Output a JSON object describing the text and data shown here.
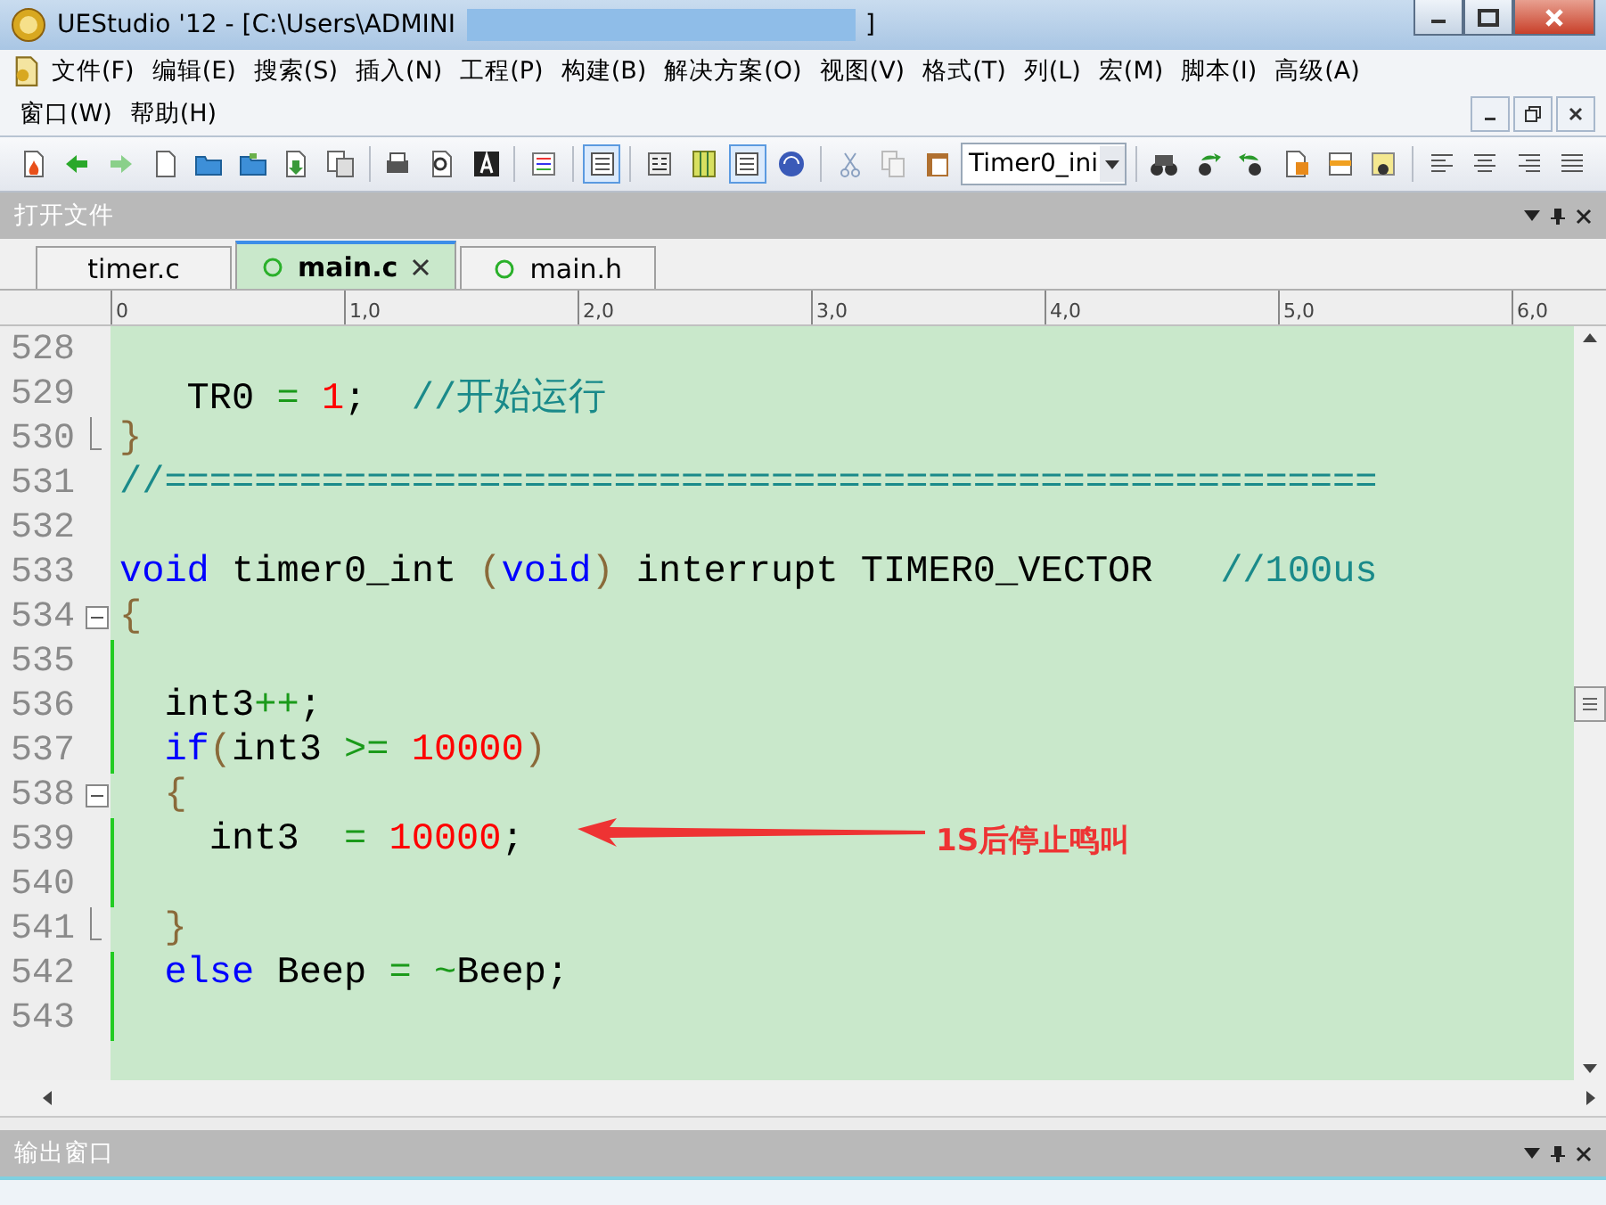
{
  "window": {
    "title": "UEStudio '12 - [C:\\Users\\ADMINI",
    "title_end": "]"
  },
  "menu": [
    "文件(F)",
    "编辑(E)",
    "搜索(S)",
    "插入(N)",
    "工程(P)",
    "构建(B)",
    "解决方案(O)",
    "视图(V)",
    "格式(T)",
    "列(L)",
    "宏(M)",
    "脚本(I)",
    "高级(A)",
    "窗口(W)",
    "帮助(H)"
  ],
  "toolbar": {
    "function_combo": "Timer0_ini"
  },
  "open_files_panel": {
    "title": "打开文件"
  },
  "tabs": [
    {
      "label": "timer.c",
      "selected": false,
      "marker": false
    },
    {
      "label": "main.c",
      "selected": true,
      "marker": true
    },
    {
      "label": "main.h",
      "selected": false,
      "marker": true
    }
  ],
  "ruler": [
    "0",
    "1,0",
    "2,0",
    "3,0",
    "4,0",
    "5,0",
    "6,0"
  ],
  "code_lines": [
    {
      "number": "528",
      "modified": false,
      "fold_start": false,
      "fold_end": false
    },
    {
      "number": "529",
      "modified": false,
      "fold_start": false,
      "fold_end": false,
      "tokens": [
        {
          "kind": "plain",
          "text": "   TR0 "
        },
        {
          "kind": "op",
          "text": "= "
        },
        {
          "kind": "number",
          "text": "1"
        },
        {
          "kind": "plain",
          "text": ";  "
        },
        {
          "kind": "comment",
          "text": "//开始运行"
        }
      ]
    },
    {
      "number": "530",
      "modified": false,
      "fold_start": false,
      "fold_end": true,
      "tokens": [
        {
          "kind": "bracket",
          "text": "}"
        }
      ]
    },
    {
      "number": "531",
      "modified": false,
      "fold_start": false,
      "fold_end": false,
      "tokens": [
        {
          "kind": "comment",
          "text": "//======================================================"
        }
      ]
    },
    {
      "number": "532",
      "modified": false,
      "fold_start": false,
      "fold_end": false
    },
    {
      "number": "533",
      "modified": false,
      "fold_start": false,
      "fold_end": false,
      "tokens": [
        {
          "kind": "keyword",
          "text": "void"
        },
        {
          "kind": "plain",
          "text": " timer0_int "
        },
        {
          "kind": "bracket",
          "text": "("
        },
        {
          "kind": "keyword",
          "text": "void"
        },
        {
          "kind": "bracket",
          "text": ")"
        },
        {
          "kind": "plain",
          "text": " interrupt TIMER0_VECTOR   "
        },
        {
          "kind": "comment",
          "text": "//100us"
        }
      ]
    },
    {
      "number": "534",
      "modified": false,
      "fold_start": true,
      "fold_end": false,
      "tokens": [
        {
          "kind": "bracket",
          "text": "{"
        }
      ]
    },
    {
      "number": "535",
      "modified": true,
      "fold_start": false,
      "fold_end": false
    },
    {
      "number": "536",
      "modified": true,
      "fold_start": false,
      "fold_end": false,
      "tokens": [
        {
          "kind": "plain",
          "text": "  int3"
        },
        {
          "kind": "op",
          "text": "++"
        },
        {
          "kind": "plain",
          "text": ";"
        }
      ]
    },
    {
      "number": "537",
      "modified": true,
      "fold_start": false,
      "fold_end": false,
      "tokens": [
        {
          "kind": "keyword",
          "text": "  if"
        },
        {
          "kind": "bracket",
          "text": "("
        },
        {
          "kind": "plain",
          "text": "int3 "
        },
        {
          "kind": "op",
          "text": ">= "
        },
        {
          "kind": "number",
          "text": "10000"
        },
        {
          "kind": "bracket",
          "text": ")"
        }
      ]
    },
    {
      "number": "538",
      "modified": false,
      "fold_start": true,
      "fold_end": false,
      "tokens": [
        {
          "kind": "bracket",
          "text": "  {"
        }
      ]
    },
    {
      "number": "539",
      "modified": true,
      "fold_start": false,
      "fold_end": false,
      "tokens": [
        {
          "kind": "plain",
          "text": "    int3  "
        },
        {
          "kind": "op",
          "text": "= "
        },
        {
          "kind": "number",
          "text": "10000"
        },
        {
          "kind": "plain",
          "text": ";"
        }
      ]
    },
    {
      "number": "540",
      "modified": true,
      "fold_start": false,
      "fold_end": false
    },
    {
      "number": "541",
      "modified": false,
      "fold_start": false,
      "fold_end": true,
      "tokens": [
        {
          "kind": "bracket",
          "text": "  }"
        }
      ]
    },
    {
      "number": "542",
      "modified": true,
      "fold_start": false,
      "fold_end": false,
      "tokens": [
        {
          "kind": "keyword",
          "text": "  else"
        },
        {
          "kind": "plain",
          "text": " Beep "
        },
        {
          "kind": "op",
          "text": "= ~"
        },
        {
          "kind": "plain",
          "text": "Beep;"
        }
      ]
    },
    {
      "number": "543",
      "modified": true,
      "fold_start": false,
      "fold_end": false
    }
  ],
  "annotation": {
    "text": "1S后停止鸣叫"
  },
  "output_panel": {
    "title": "输出窗口"
  }
}
